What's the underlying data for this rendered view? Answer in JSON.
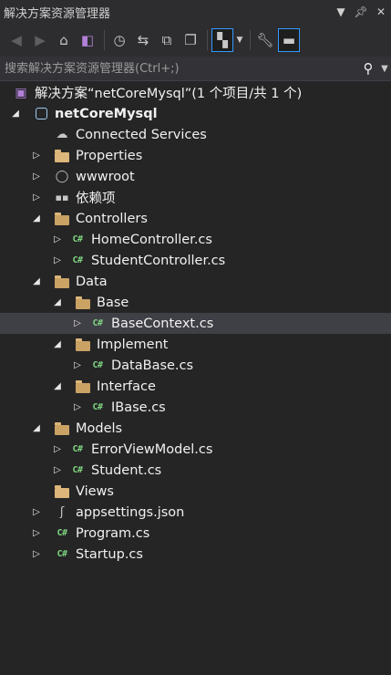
{
  "window": {
    "title": "解决方案资源管理器"
  },
  "search": {
    "placeholder": "搜索解决方案资源管理器(Ctrl+;)"
  },
  "tree": {
    "solution": {
      "label": "解决方案“netCoreMysql”(1 个项目/共 1 个)"
    },
    "project": {
      "label": "netCoreMysql"
    },
    "items": [
      {
        "label": "Connected Services",
        "icon": "cloud-icon"
      },
      {
        "label": "Properties",
        "icon": "properties-icon"
      },
      {
        "label": "wwwroot",
        "icon": "globe-icon"
      },
      {
        "label": "依赖项",
        "icon": "dependencies-icon"
      },
      {
        "label": "Controllers",
        "icon": "folder-open-icon"
      },
      {
        "label": "HomeController.cs",
        "icon": "csharp-file-icon"
      },
      {
        "label": "StudentController.cs",
        "icon": "csharp-file-icon"
      },
      {
        "label": "Data",
        "icon": "folder-open-icon"
      },
      {
        "label": "Base",
        "icon": "folder-open-icon"
      },
      {
        "label": "BaseContext.cs",
        "icon": "csharp-file-icon"
      },
      {
        "label": "Implement",
        "icon": "folder-open-icon"
      },
      {
        "label": "DataBase.cs",
        "icon": "csharp-file-icon"
      },
      {
        "label": "Interface",
        "icon": "folder-open-icon"
      },
      {
        "label": "IBase.cs",
        "icon": "csharp-file-icon"
      },
      {
        "label": "Models",
        "icon": "folder-open-icon"
      },
      {
        "label": "ErrorViewModel.cs",
        "icon": "csharp-file-icon"
      },
      {
        "label": "Student.cs",
        "icon": "csharp-file-icon"
      },
      {
        "label": "Views",
        "icon": "folder-icon"
      },
      {
        "label": "appsettings.json",
        "icon": "json-file-icon"
      },
      {
        "label": "Program.cs",
        "icon": "csharp-file-icon"
      },
      {
        "label": "Startup.cs",
        "icon": "csharp-file-icon"
      }
    ]
  },
  "colors": {
    "background": "#252526",
    "toolbar": "#2d2d30",
    "selection": "#3f3f46",
    "accent": "#3399ff",
    "csharp": "#7fd57f",
    "folder": "#dcb67a"
  }
}
